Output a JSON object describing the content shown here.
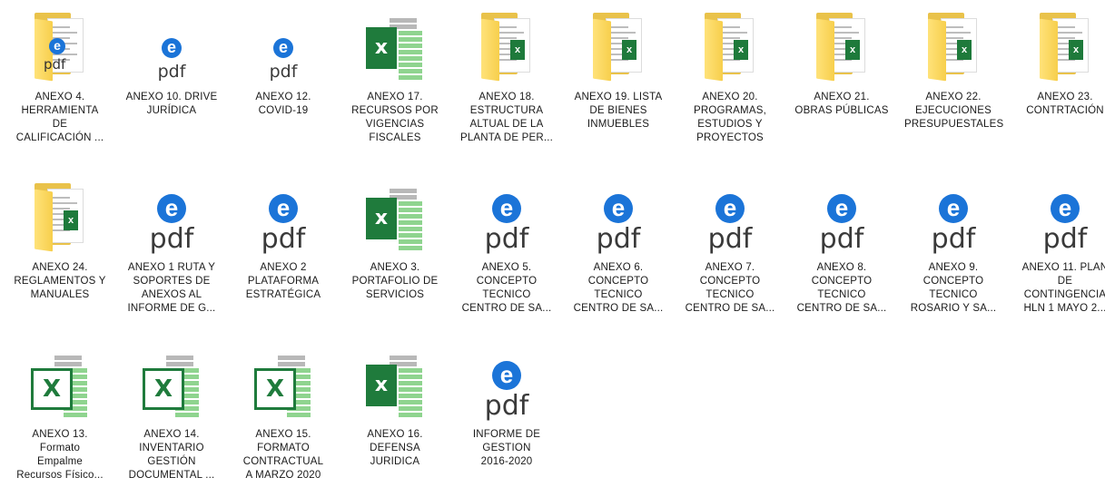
{
  "files": [
    {
      "label": "ANEXO 4.\nHERRAMIENTA\nDE\nCALIFICACIÓN ...",
      "icon": "folder-pdf-icon",
      "type": "folder-pdf",
      "pdf_text": "pdf"
    },
    {
      "label": "ANEXO 10. DRIVE\nJURÍDICA",
      "icon": "pdf-icon",
      "type": "pdf-small",
      "pdf_text": "pdf"
    },
    {
      "label": "ANEXO 12.\nCOVID-19",
      "icon": "pdf-icon",
      "type": "pdf-small",
      "pdf_text": "pdf"
    },
    {
      "label": "ANEXO 17.\nRECURSOS POR\nVIGENCIAS\nFISCALES",
      "icon": "excel-icon",
      "type": "excel"
    },
    {
      "label": "ANEXO 18.\nESTRUCTURA\nALTUAL DE LA\nPLANTA DE PER...",
      "icon": "folder-excel-icon",
      "type": "folder"
    },
    {
      "label": "ANEXO 19. LISTA\nDE BIENES\nINMUEBLES",
      "icon": "folder-excel-icon",
      "type": "folder"
    },
    {
      "label": "ANEXO 20.\nPROGRAMAS,\nESTUDIOS Y\nPROYECTOS",
      "icon": "folder-excel-icon",
      "type": "folder"
    },
    {
      "label": "ANEXO 21.\nOBRAS PÚBLICAS",
      "icon": "folder-excel-icon",
      "type": "folder"
    },
    {
      "label": "ANEXO 22.\nEJECUCIONES\nPRESUPUESTALES",
      "icon": "folder-excel-icon",
      "type": "folder"
    },
    {
      "label": "ANEXO 23.\nCONTRTACIÓN",
      "icon": "folder-excel-icon",
      "type": "folder"
    },
    {
      "label": "ANEXO 24.\nREGLAMENTOS Y\nMANUALES",
      "icon": "folder-excel-icon",
      "type": "folder"
    },
    {
      "label": "ANEXO 1 RUTA Y\nSOPORTES DE\nANEXOS AL\nINFORME DE G...",
      "icon": "pdf-icon",
      "type": "pdf",
      "pdf_text": "pdf"
    },
    {
      "label": "ANEXO 2\nPLATAFORMA\nESTRATÉGICA",
      "icon": "pdf-icon",
      "type": "pdf",
      "pdf_text": "pdf"
    },
    {
      "label": "ANEXO 3.\nPORTAFOLIO DE\nSERVICIOS",
      "icon": "excel-icon",
      "type": "excel"
    },
    {
      "label": "ANEXO 5.\nCONCEPTO\nTECNICO\nCENTRO DE SA...",
      "icon": "pdf-icon",
      "type": "pdf",
      "pdf_text": "pdf"
    },
    {
      "label": "ANEXO 6.\nCONCEPTO\nTECNICO\nCENTRO DE SA...",
      "icon": "pdf-icon",
      "type": "pdf",
      "pdf_text": "pdf"
    },
    {
      "label": "ANEXO 7.\nCONCEPTO\nTECNICO\nCENTRO DE SA...",
      "icon": "pdf-icon",
      "type": "pdf",
      "pdf_text": "pdf"
    },
    {
      "label": "ANEXO 8.\nCONCEPTO\nTECNICO\nCENTRO DE SA...",
      "icon": "pdf-icon",
      "type": "pdf",
      "pdf_text": "pdf"
    },
    {
      "label": "ANEXO 9.\nCONCEPTO\nTECNICO\nROSARIO Y SA...",
      "icon": "pdf-icon",
      "type": "pdf",
      "pdf_text": "pdf"
    },
    {
      "label": "ANEXO 11. PLAN\nDE\nCONTINGENCIA\nHLN 1 MAYO 2...",
      "icon": "pdf-icon",
      "type": "pdf",
      "pdf_text": "pdf"
    },
    {
      "label": "ANEXO 13.\nFormato\nEmpalme\nRecursos Físico...",
      "icon": "excel-old-icon",
      "type": "excel-old"
    },
    {
      "label": "ANEXO 14.\nINVENTARIO\nGESTIÓN\nDOCUMENTAL ...",
      "icon": "excel-old-icon",
      "type": "excel-old"
    },
    {
      "label": "ANEXO 15.\nFORMATO\nCONTRACTUAL\nA MARZO 2020",
      "icon": "excel-old-icon",
      "type": "excel-old"
    },
    {
      "label": "ANEXO 16.\nDEFENSA\nJURIDICA",
      "icon": "excel-icon",
      "type": "excel"
    },
    {
      "label": "INFORME DE\nGESTION\n2016-2020",
      "icon": "pdf-icon",
      "type": "pdf",
      "pdf_text": "pdf"
    }
  ],
  "colors": {
    "folder": "#f7cf4c",
    "excel": "#1f7b3c",
    "edge": "#1b74d8"
  }
}
